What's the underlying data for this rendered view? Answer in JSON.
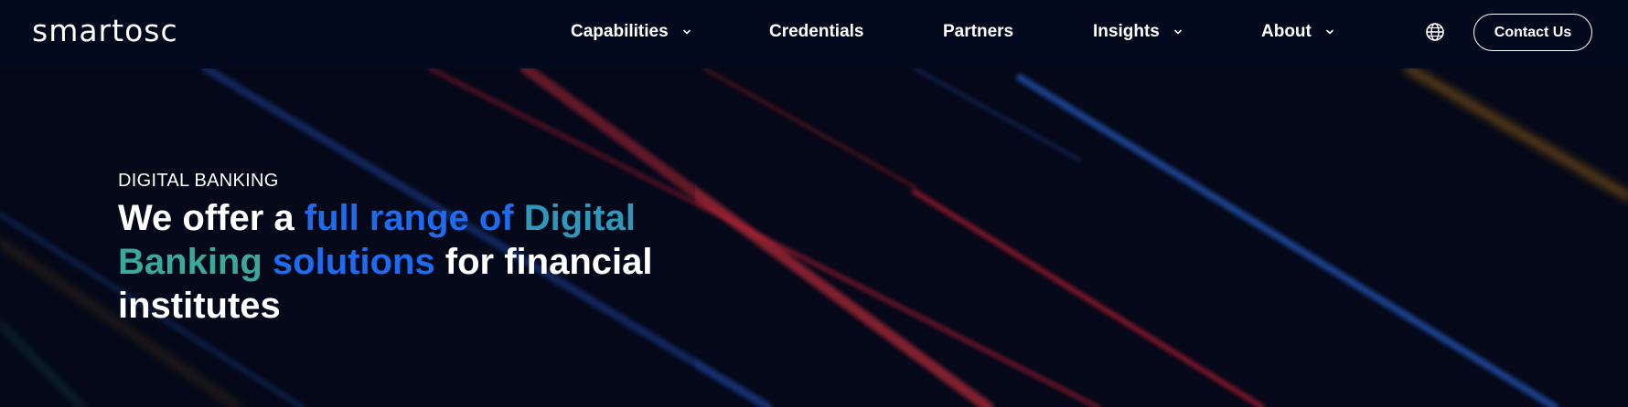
{
  "header": {
    "logo_text": "smartosc",
    "nav": [
      {
        "label": "Capabilities",
        "has_dropdown": true
      },
      {
        "label": "Credentials",
        "has_dropdown": false
      },
      {
        "label": "Partners",
        "has_dropdown": false
      },
      {
        "label": "Insights",
        "has_dropdown": true
      },
      {
        "label": "About",
        "has_dropdown": true
      }
    ],
    "language_icon": "globe-icon",
    "contact_label": "Contact Us"
  },
  "hero": {
    "eyebrow": "DIGITAL BANKING",
    "headline": {
      "part1": "We offer a ",
      "part2": "full range of ",
      "part3": "Digital",
      "part4": "Banking",
      "part5": " solutions",
      "part6": " for financial institutes"
    }
  },
  "colors": {
    "background": "#050a1c",
    "highlight_blue": "#1f6bf0",
    "highlight_teal": "#2f97b8",
    "highlight_green": "#3aa89a"
  }
}
